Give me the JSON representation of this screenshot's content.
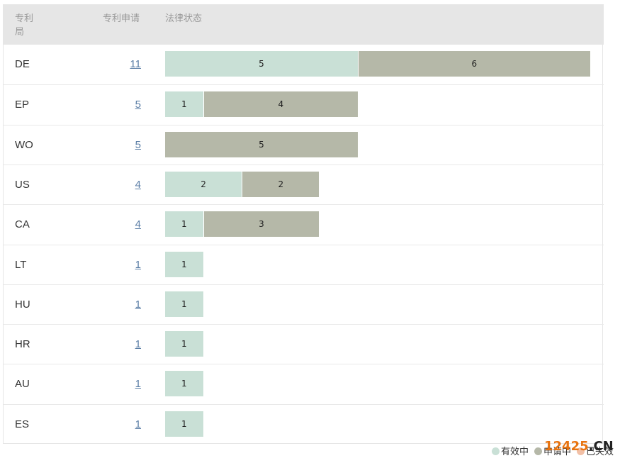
{
  "table": {
    "header_office": "专利局",
    "header_count": "专利申请",
    "header_status": "法律状态"
  },
  "legend": [
    {
      "label": "有效中",
      "color": "#c9e0d6"
    },
    {
      "label": "申请中",
      "color": "#b5b8a8"
    },
    {
      "label": "已失效",
      "color": "#f2c0a6"
    }
  ],
  "watermark": {
    "main": "12425",
    "suffix": ".CN"
  },
  "colors": {
    "valid": "#c9e0d6",
    "pending": "#b5b8a8",
    "invalid": "#f2c0a6",
    "link": "#5b7ea6"
  },
  "chart_data": {
    "type": "bar",
    "orientation": "horizontal-stacked",
    "categories": [
      "DE",
      "EP",
      "WO",
      "US",
      "CA",
      "LT",
      "HU",
      "HR",
      "AU",
      "ES"
    ],
    "totals": [
      11,
      5,
      5,
      4,
      4,
      1,
      1,
      1,
      1,
      1
    ],
    "series": [
      {
        "name": "有效中",
        "values": [
          5,
          1,
          0,
          2,
          1,
          1,
          1,
          1,
          1,
          1
        ]
      },
      {
        "name": "申请中",
        "values": [
          6,
          4,
          5,
          2,
          3,
          0,
          0,
          0,
          0,
          0
        ]
      },
      {
        "name": "已失效",
        "values": [
          0,
          0,
          0,
          0,
          0,
          0,
          0,
          0,
          0,
          0
        ]
      }
    ],
    "title": "",
    "xlabel": "",
    "ylabel": "",
    "legend_position": "bottom-right"
  }
}
